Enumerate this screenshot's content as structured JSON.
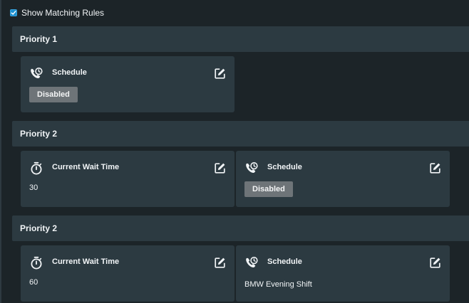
{
  "toolbar": {
    "show_matching_rules_label": "Show Matching Rules",
    "show_matching_rules_checked": true
  },
  "groups": [
    {
      "title": "Priority 1",
      "cards": [
        {
          "title": "Schedule",
          "icon": "phone-clock-icon",
          "status": "Disabled"
        }
      ]
    },
    {
      "title": "Priority 2",
      "cards": [
        {
          "title": "Current Wait Time",
          "icon": "stopwatch-icon",
          "value": "30"
        },
        {
          "title": "Schedule",
          "icon": "phone-clock-icon",
          "status": "Disabled"
        }
      ]
    },
    {
      "title": "Priority 2",
      "cards": [
        {
          "title": "Current Wait Time",
          "icon": "stopwatch-icon",
          "value": "60"
        },
        {
          "title": "Schedule",
          "icon": "phone-clock-icon",
          "value": "BMW Evening Shift"
        }
      ]
    }
  ],
  "colors": {
    "background": "#1c2428",
    "panel": "#2c3a41",
    "checkbox_accent": "#1b90d0",
    "badge": "#6e7478",
    "text": "#f1f4f6"
  }
}
